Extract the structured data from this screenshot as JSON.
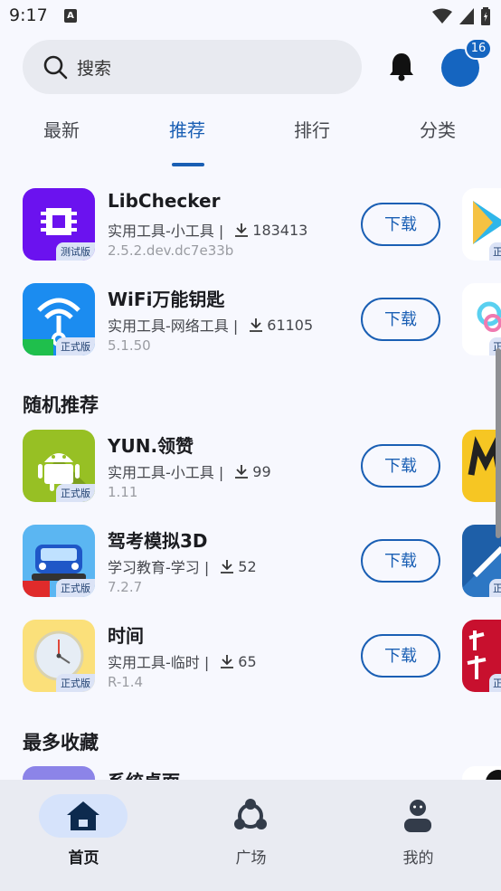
{
  "status_bar": {
    "time": "9:17",
    "notif_icon": "A"
  },
  "search": {
    "placeholder": "搜索"
  },
  "notifications": {
    "badge_count": "16"
  },
  "tabs": [
    {
      "label": "最新",
      "active": false
    },
    {
      "label": "推荐",
      "active": true
    },
    {
      "label": "排行",
      "active": false
    },
    {
      "label": "分类",
      "active": false
    }
  ],
  "top_list": [
    {
      "name": "LibChecker",
      "category": "实用工具-小工具 |",
      "downloads": "183413",
      "version": "2.5.2.dev.dc7e33b",
      "badge": "测试版",
      "button": "下载"
    },
    {
      "name": "WiFi万能钥匙",
      "category": "实用工具-网络工具 |",
      "downloads": "61105",
      "version": "5.1.50",
      "badge": "正式版",
      "button": "下载"
    }
  ],
  "random_section": {
    "title": "随机推荐",
    "items": [
      {
        "name": "YUN.领赞",
        "category": "实用工具-小工具 |",
        "downloads": "99",
        "version": "1.11",
        "badge": "正式版",
        "button": "下载"
      },
      {
        "name": "驾考模拟3D",
        "category": "学习教育-学习 |",
        "downloads": "52",
        "version": "7.2.7",
        "badge": "正式版",
        "button": "下载"
      },
      {
        "name": "时间",
        "category": "实用工具-临时 |",
        "downloads": "65",
        "version": "R-1.4",
        "badge": "正式版",
        "button": "下载"
      }
    ]
  },
  "favorites_section": {
    "title": "最多收藏",
    "first_item_name": "系统桌面"
  },
  "peek_badges": [
    "正",
    "正",
    "正",
    "正"
  ],
  "bottom_nav": [
    {
      "label": "首页",
      "icon": "home-icon",
      "active": true
    },
    {
      "label": "广场",
      "icon": "community-icon",
      "active": false
    },
    {
      "label": "我的",
      "icon": "profile-icon",
      "active": false
    }
  ],
  "colors": {
    "accent": "#1a5fb4",
    "background": "#f7f8fe",
    "nav_background": "#e9ebf2"
  }
}
